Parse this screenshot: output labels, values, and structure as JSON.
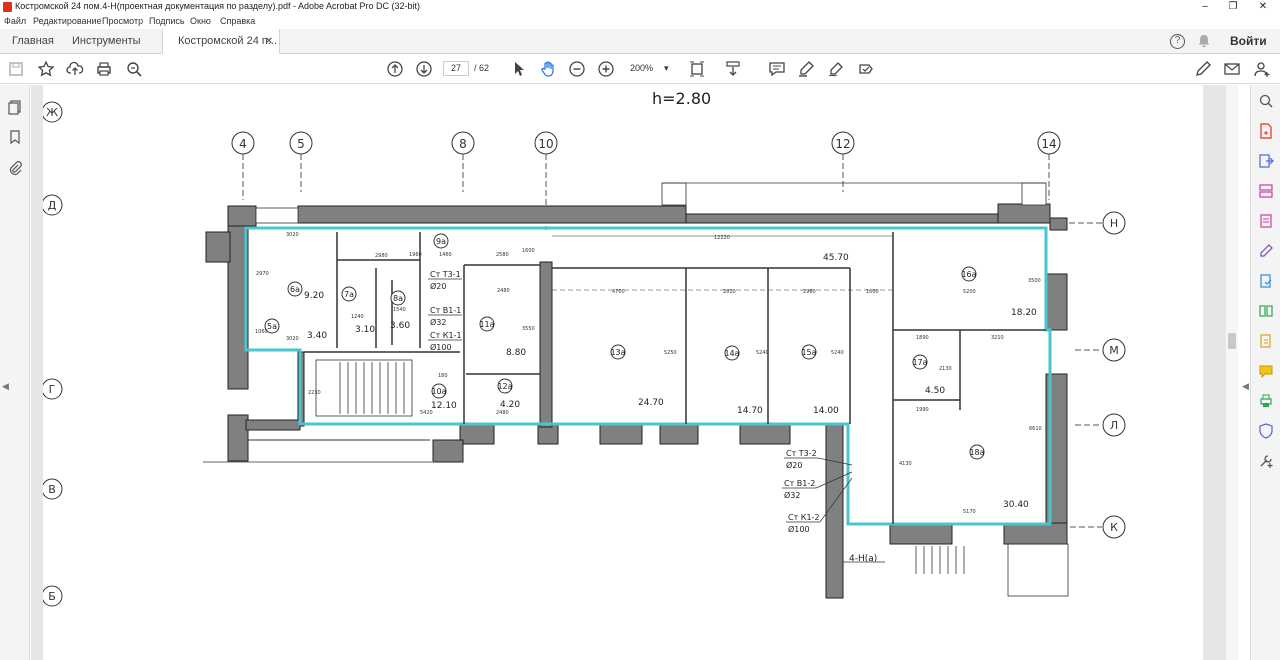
{
  "window": {
    "title": "Костромской 24 пом.4-Н(проектная документация по разделу).pdf - Adobe Acrobat Pro DC (32-bit)",
    "controls": [
      "–",
      "❐",
      "✕"
    ]
  },
  "menu": [
    "Файл",
    "Редактирование",
    "Просмотр",
    "Подпись",
    "Окно",
    "Справка"
  ],
  "tabs": {
    "home": "Главная",
    "tools": "Инструменты",
    "doc": "Костромской 24 п...",
    "close": "✕"
  },
  "account": {
    "login": "Войти",
    "help": "?",
    "bell": "bell-icon"
  },
  "toolbar": {
    "page_current": "27",
    "page_total": "/ 62",
    "zoom": "200%",
    "zoom_caret": "▾"
  },
  "drawing": {
    "height_note": "h=2.80",
    "col_axes": [
      "4",
      "5",
      "8",
      "10",
      "12",
      "14"
    ],
    "row_axes_left": [
      "Ж",
      "Д",
      "Г",
      "В",
      "Б"
    ],
    "row_axes_right": [
      "Н",
      "М",
      "Л",
      "К"
    ],
    "rooms": [
      {
        "id": "6а",
        "area": "9.20"
      },
      {
        "id": "5а",
        "area": "3.40"
      },
      {
        "id": "7а",
        "area": "3.10"
      },
      {
        "id": "8а",
        "area": "3.60"
      },
      {
        "id": "9а",
        "area": ""
      },
      {
        "id": "10а",
        "area": "12.10"
      },
      {
        "id": "11а",
        "area": "8.80"
      },
      {
        "id": "12а",
        "area": "4.20"
      },
      {
        "id": "13а",
        "area": "24.70"
      },
      {
        "id": "14а",
        "area": "14.70"
      },
      {
        "id": "15а",
        "area": "14.00"
      },
      {
        "id": "16а",
        "area": "18.20"
      },
      {
        "id": "17а",
        "area": "4.50"
      },
      {
        "id": "18а",
        "area": "30.40"
      }
    ],
    "corridor_area": "45.70",
    "dims": [
      "3020",
      "2980",
      "1460",
      "2580",
      "12220",
      "4700",
      "2810",
      "2960",
      "1600",
      "5200",
      "2480",
      "3210",
      "1890",
      "1990",
      "5170",
      "5420",
      "3020",
      "2480",
      "1240",
      "1540",
      "3550",
      "5250",
      "5240",
      "5240",
      "3500",
      "6610",
      "4130",
      "2130",
      "1960",
      "1600",
      "2230",
      "2970",
      "180",
      "1060"
    ],
    "risers_left": [
      {
        "name": "Ст Т3-1",
        "d": "Ø20"
      },
      {
        "name": "Ст В1-1",
        "d": "Ø32"
      },
      {
        "name": "Ст К1-1",
        "d": "Ø100"
      }
    ],
    "risers_right": [
      {
        "name": "Ст Т3-2",
        "d": "Ø20"
      },
      {
        "name": "Ст В1-2",
        "d": "Ø32"
      },
      {
        "name": "Ст К1-2",
        "d": "Ø100"
      }
    ],
    "unit_label": "4-Н(а)"
  },
  "colors": {
    "wall": "#808080",
    "outline": "#49c6cf",
    "pdf_red": "#e0301e",
    "accent": "#1473e6"
  }
}
